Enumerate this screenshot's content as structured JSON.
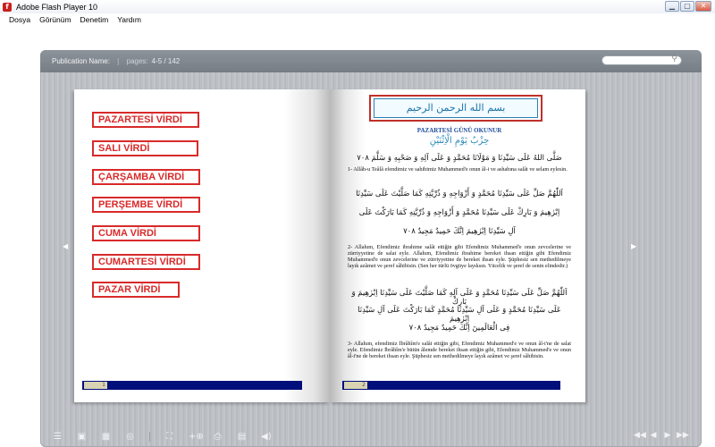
{
  "window": {
    "title": "Adobe Flash Player 10",
    "controls": {
      "minimize": "▁",
      "maximize": "▢",
      "close": "✕"
    }
  },
  "menu": [
    "Dosya",
    "Görünüm",
    "Denetim",
    "Yardım"
  ],
  "viewer": {
    "publication_label": "Publication Name:",
    "separator": "|",
    "pages_label": "pages:",
    "pages_value": "4-5 / 142",
    "search_placeholder": ""
  },
  "left_page": {
    "virds": [
      "PAZARTESİ VİRDİ",
      "SALI VİRDİ",
      "ÇARŞAMBA VİRDİ",
      "PERŞEMBE VİRDİ",
      "CUMA VİRDİ",
      "CUMARTESİ VİRDİ",
      "PAZAR VİRDİ"
    ],
    "page_number": "1"
  },
  "right_page": {
    "banner": "بسم الله الرحمن الرحيم",
    "heading": "PAZARTESİ GÜNÜ OKUNUR",
    "sub_arabic": "حِزْبُ يَوْمِ الْاِثْنَيْنِ",
    "arabic_1": "صَلَّى اللهُ عَلَى سَيِّدِنَا وَ مَوْلَانَا مُحَمَّدٍ وَ عَلَى آلِهِ وَ صَحْبِهِ وَ سَلَّمَ ٧٠٨",
    "para_1": "1- Allâh-u Teâlâ efendimiz ve sahibimiz Muhammed'e onun âl-i ve ashabına salât ve selam eylesin.",
    "arabic_2": "اَللّٰهُمَّ صَلِّ عَلَى سَيِّدِنَا مُحَمَّدٍ وَ أَزْوَاجِهِ وَ ذُرِّيَّتِهِ كَمَا صَلَّيْتَ عَلَى سَيِّدِنَا",
    "arabic_3": "اِبْرٰهِيمَ وَ بَارِكْ عَلَى سَيِّدِنَا مُحَمَّدٍ وَ أَزْوَاجِهِ وَ ذُرِّيَّتِهِ كَمَا بَارَكْتَ عَلَى",
    "arabic_4": "آلِ سَيِّدِنَا اِبْرٰهِيمَ اِنَّكَ حَمِيدٌ مَجِيدٌ ٧٠٨",
    "para_2": "2- Allahım, Efendimiz ibrahime salât ettiğin gibi Efendimiz Muhammed'e onun zevcelerine ve zürriyyetine de salat eyle. Allahım, Efendimiz ibrahime bereket ihsan ettiğin gibi Efendimiz Muhammed'e onun zevcelerine ve zürriyyetine de bereket ihsan eyle. Şüphesiz sen methedilmeye layık azâmet ve şeref sâhibisin. (Sen her türlü övgüye layıksın. Yücelik ve şeref de senin elindedir.)",
    "arabic_5": "اَللّٰهُمَّ صَلِّ عَلَى سَيِّدِنَا مُحَمَّدٍ وَ عَلَى آلِهِ كَمَا صَلَّيْتَ عَلَى سَيِّدِنَا اِبْرٰهِيمَ وَ بَارِكْ",
    "arabic_6": "عَلَى سَيِّدِنَا مُحَمَّدٍ وَ عَلَى آلِ سَيِّدِنَا مُحَمَّدٍ كَمَا بَارَكْتَ عَلَى آلِ سَيِّدِنَا اِبْرٰهِيمَ",
    "arabic_7": "فِى الْعَالَمِينَ اِنَّكَ حَمِيدٌ مَجِيدٌ ٧٠٨",
    "para_3": "3- Allahım, efendimiz İbrâhîm'e salât ettiğin gibi, Efendimiz Muhammed'e ve onun âl-i'ne de salat eyle. Efendimiz İbrâhîm'e bütün âlemde bereket ihsan ettiğin gibi, Efendimiz Muhammed'e ve onun âl-i'ne de bereket ihsan eyle. Şüphesiz sen methedilmeye layık azâmet ve şeref sâhibisin.",
    "page_number": "2"
  },
  "toolbar": {
    "left_icons": [
      "☰",
      "▣",
      "▦",
      "◎",
      "|",
      "⛶",
      "+⊕",
      "⎙",
      "▤",
      "◀)"
    ],
    "right_icons": [
      "◀◀",
      "◀",
      "▶",
      "▶▶"
    ]
  },
  "nav": {
    "prev": "◀",
    "next": "▶"
  }
}
